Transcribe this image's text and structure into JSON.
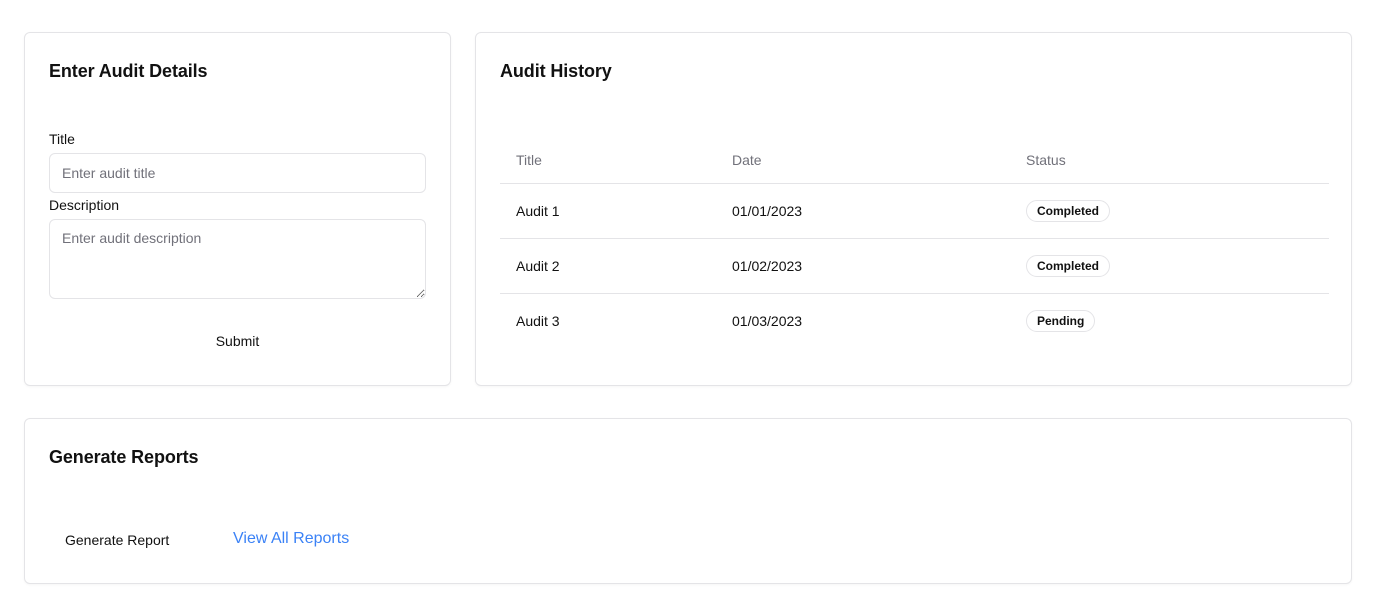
{
  "audit_details": {
    "heading": "Enter Audit Details",
    "title_label": "Title",
    "title_placeholder": "Enter audit title",
    "title_value": "",
    "description_label": "Description",
    "description_placeholder": "Enter audit description",
    "description_value": "",
    "submit_label": "Submit"
  },
  "audit_history": {
    "heading": "Audit History",
    "columns": [
      "Title",
      "Date",
      "Status"
    ],
    "rows": [
      {
        "title": "Audit 1",
        "date": "01/01/2023",
        "status": "Completed"
      },
      {
        "title": "Audit 2",
        "date": "01/02/2023",
        "status": "Completed"
      },
      {
        "title": "Audit 3",
        "date": "01/03/2023",
        "status": "Pending"
      }
    ]
  },
  "reports": {
    "heading": "Generate Reports",
    "generate_label": "Generate Report",
    "view_all_label": "View All Reports"
  },
  "colors": {
    "link": "#3b82f6",
    "border": "#e4e4e7",
    "muted_text": "#71717a"
  }
}
